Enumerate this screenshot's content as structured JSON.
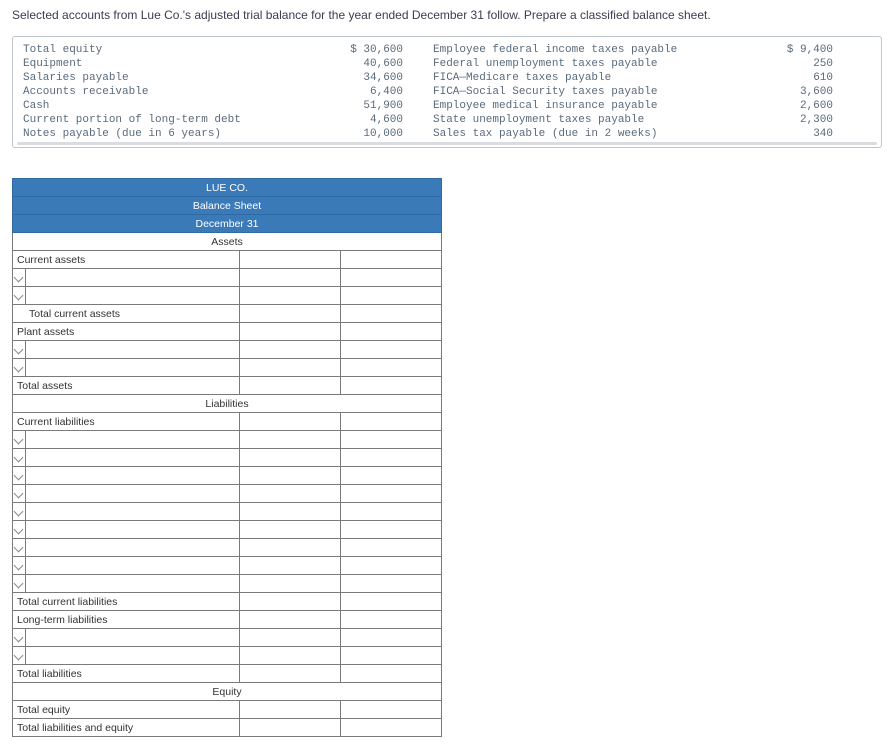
{
  "instruction": "Selected accounts from Lue Co.'s adjusted trial balance for the year ended December 31 follow. Prepare a classified balance sheet.",
  "tb": {
    "leftNames": [
      "Total equity",
      "Equipment",
      "Salaries payable",
      "Accounts receivable",
      "Cash",
      "Current portion of long-term debt",
      "Notes payable (due in 6 years)"
    ],
    "leftVals": [
      "$ 30,600",
      "40,600",
      "34,600",
      "6,400",
      "51,900",
      "4,600",
      "10,000"
    ],
    "rightNames": [
      "Employee federal income taxes payable",
      "Federal unemployment taxes payable",
      "FICA—Medicare taxes payable",
      "FICA—Social Security taxes payable",
      "Employee medical insurance payable",
      "State unemployment taxes payable",
      "Sales tax payable (due in 2 weeks)"
    ],
    "rightVals": [
      "$ 9,400",
      "250",
      "610",
      "3,600",
      "2,600",
      "2,300",
      "340"
    ]
  },
  "ws": {
    "company": "LUE CO.",
    "title": "Balance Sheet",
    "date": "December 31",
    "sec_assets": "Assets",
    "current_assets": "Current assets",
    "total_current_assets": "Total current assets",
    "plant_assets": "Plant assets",
    "total_assets": "Total assets",
    "sec_liab": "Liabilities",
    "current_liabilities": "Current liabilities",
    "total_current_liabilities": "Total current liabilities",
    "long_term_liabilities": "Long-term liabilities",
    "total_liabilities": "Total liabilities",
    "sec_equity": "Equity",
    "total_equity": "Total equity",
    "total_liab_equity": "Total liabilities and equity"
  }
}
